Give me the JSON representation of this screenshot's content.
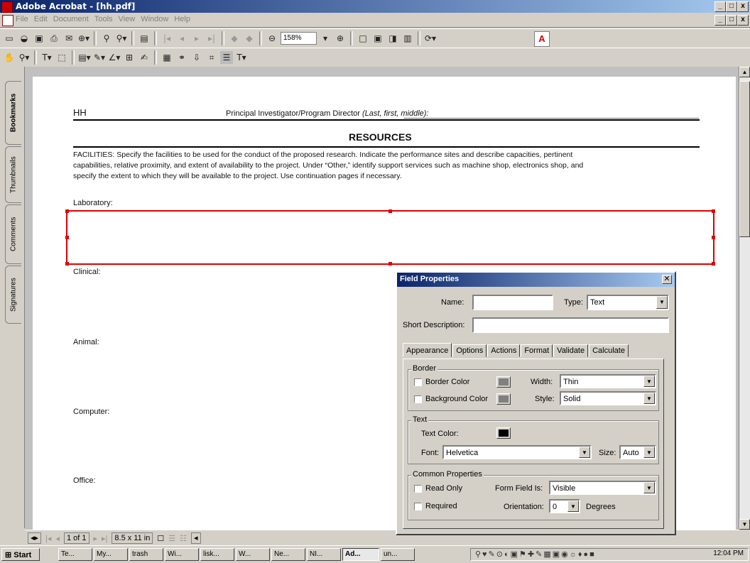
{
  "window": {
    "title": "Adobe Acrobat - [hh.pdf]",
    "controls": [
      "_",
      "□",
      "x"
    ]
  },
  "menubar": {
    "items": [
      "File",
      "Edit",
      "Document",
      "Tools",
      "View",
      "Window",
      "Help"
    ]
  },
  "toolbar": {
    "zoom": "158%"
  },
  "sidetabs": [
    "Bookmarks",
    "Thumbnails",
    "Comments",
    "Signatures"
  ],
  "document": {
    "header_left": "HH",
    "header_pi_label": "Principal Investigator/Program Director",
    "header_pi_hint": "(Last, first, middle):",
    "heading": "RESOURCES",
    "intro_line1": "FACILITIES:  Specify the facilities to be used for the conduct of the proposed research. Indicate the performance sites and describe capacities, pertinent",
    "intro_line2": "capabilities, relative proximity, and extent of availability to the project. Under “Other,” identify support services such as machine shop, electronics shop, and",
    "intro_line3": "specify the extent to which they will be available to the project. Use continuation pages if necessary.",
    "sections": [
      "Laboratory:",
      "Clinical:",
      "Animal:",
      "Computer:",
      "Office:"
    ]
  },
  "statusbar": {
    "page": "1 of 1",
    "size": "8.5 x 11 in"
  },
  "dialog": {
    "title": "Field Properties",
    "name_label": "Name:",
    "name_value": "",
    "type_label": "Type:",
    "type_value": "Text",
    "short_desc_label": "Short Description:",
    "short_desc_value": "",
    "tabs": [
      "Appearance",
      "Options",
      "Actions",
      "Format",
      "Validate",
      "Calculate"
    ],
    "active_tab": "Appearance",
    "border_group": "Border",
    "border_color_label": "Border Color",
    "bg_color_label": "Background Color",
    "width_label": "Width:",
    "width_value": "Thin",
    "style_label": "Style:",
    "style_value": "Solid",
    "text_group": "Text",
    "text_color_label": "Text Color:",
    "font_label": "Font:",
    "font_value": "Helvetica",
    "size_label": "Size:",
    "size_value": "Auto",
    "common_group": "Common Properties",
    "read_only_label": "Read Only",
    "required_label": "Required",
    "form_field_label": "Form Field Is:",
    "form_field_value": "Visible",
    "orientation_label": "Orientation:",
    "orientation_value": "0",
    "degrees_label": "Degrees",
    "swatch_gray": "#808080",
    "swatch_black": "#000000"
  },
  "taskbar": {
    "start": "Start",
    "tasks": [
      "Te...",
      "My...",
      "trash",
      "Wi...",
      "lisk...",
      "W...",
      "Ne...",
      "NI...",
      "Ad...",
      "un..."
    ],
    "clock": "12:04 PM"
  }
}
